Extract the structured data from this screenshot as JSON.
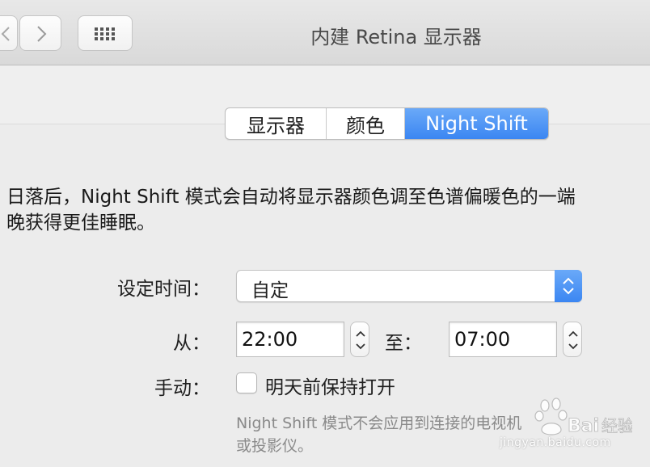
{
  "window": {
    "title": "内建 Retina 显示器"
  },
  "toolbar": {
    "back_icon": "chevron-left-icon",
    "forward_icon": "chevron-right-icon",
    "show_all_icon": "grid-icon"
  },
  "tabs": [
    {
      "label": "显示器",
      "selected": false
    },
    {
      "label": "颜色",
      "selected": false
    },
    {
      "label": "Night Shift",
      "selected": true
    }
  ],
  "description": {
    "line1": "日落后，Night Shift 模式会自动将显示器颜色调至色谱偏暖色的一端",
    "line2": "晚获得更佳睡眠。"
  },
  "schedule": {
    "label": "设定时间：",
    "value": "自定"
  },
  "time_range": {
    "from_label": "从：",
    "from_value": "22:00",
    "to_label": "至：",
    "to_value": "07:00"
  },
  "manual": {
    "label": "手动：",
    "checkbox_label": "明天前保持打开",
    "checked": false
  },
  "note": {
    "line1": "Night Shift 模式不会应用到连接的电视机",
    "line2": "或投影仪。"
  },
  "watermark": {
    "url": "jingyan.baidu.com"
  },
  "colors": {
    "accent": "#3b86f2",
    "window_bg": "#ececec"
  }
}
